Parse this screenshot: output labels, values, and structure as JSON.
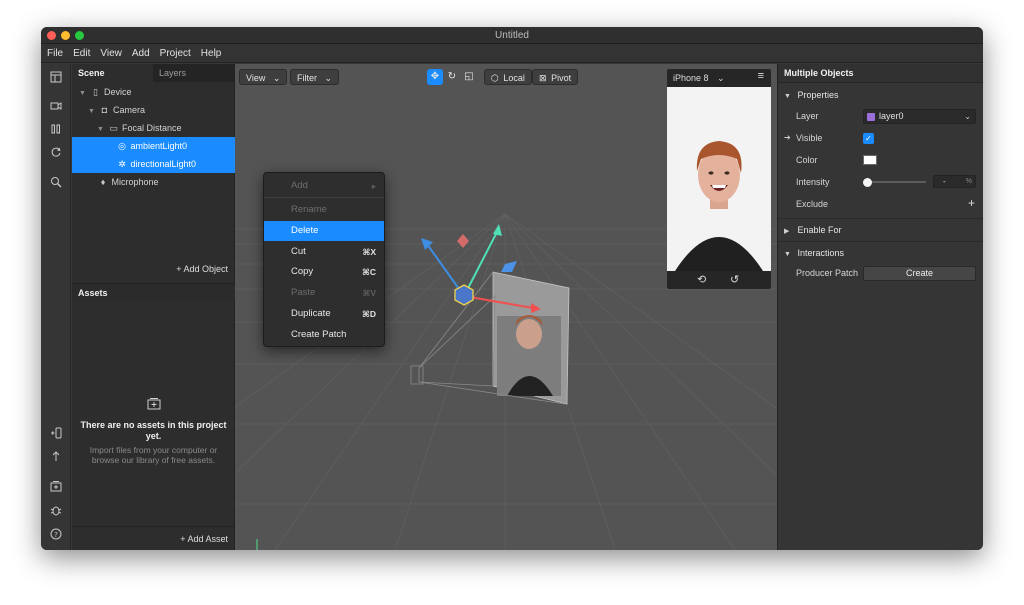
{
  "window": {
    "title": "Untitled"
  },
  "menu": [
    "File",
    "Edit",
    "View",
    "Add",
    "Project",
    "Help"
  ],
  "scene_panel": {
    "tabs": [
      "Scene",
      "Layers"
    ],
    "tree": [
      {
        "label": "Device",
        "icon": "device-icon"
      },
      {
        "label": "Camera",
        "icon": "camera-icon"
      },
      {
        "label": "Focal Distance",
        "icon": "focal-distance-icon"
      },
      {
        "label": "ambientLight0",
        "icon": "ambient-light-icon"
      },
      {
        "label": "directionalLight0",
        "icon": "directional-light-icon"
      },
      {
        "label": "Microphone",
        "icon": "microphone-icon"
      }
    ],
    "add_object": "+ Add Object"
  },
  "assets_panel": {
    "title": "Assets",
    "empty_title": "There are no assets in this project yet.",
    "empty_desc": "Import files from your computer or browse our library of free assets.",
    "add_asset": "+ Add Asset"
  },
  "viewport": {
    "view_btn": "View",
    "filter_btn": "Filter",
    "local_btn": "Local",
    "pivot_btn": "Pivot"
  },
  "preview": {
    "device": "iPhone 8"
  },
  "context_menu": {
    "items": [
      {
        "label": "Add",
        "shortcut": "",
        "disabled": true,
        "submenu": true
      },
      {
        "label": "Rename",
        "shortcut": "",
        "disabled": true
      },
      {
        "label": "Delete",
        "shortcut": "",
        "disabled": false,
        "highlighted": true
      },
      {
        "label": "Cut",
        "shortcut": "⌘X",
        "disabled": false
      },
      {
        "label": "Copy",
        "shortcut": "⌘C",
        "disabled": false
      },
      {
        "label": "Paste",
        "shortcut": "⌘V",
        "disabled": true
      },
      {
        "label": "Duplicate",
        "shortcut": "⌘D",
        "disabled": false
      },
      {
        "label": "Create Patch",
        "shortcut": "",
        "disabled": false
      }
    ]
  },
  "inspector": {
    "title": "Multiple Objects",
    "properties_label": "Properties",
    "layer_label": "Layer",
    "layer_value": "layer0",
    "layer_color": "#9b6fd8",
    "visible_label": "Visible",
    "visible_checked": true,
    "color_label": "Color",
    "color_value": "#ffffff",
    "intensity_label": "Intensity",
    "intensity_value": "-",
    "intensity_unit": "%",
    "exclude_label": "Exclude",
    "enable_for_label": "Enable For",
    "interactions_label": "Interactions",
    "producer_patch_label": "Producer Patch",
    "create_label": "Create"
  },
  "colors": {
    "accent": "#1a8cff",
    "panel": "#2d2d2d",
    "viewport": "#545454"
  }
}
